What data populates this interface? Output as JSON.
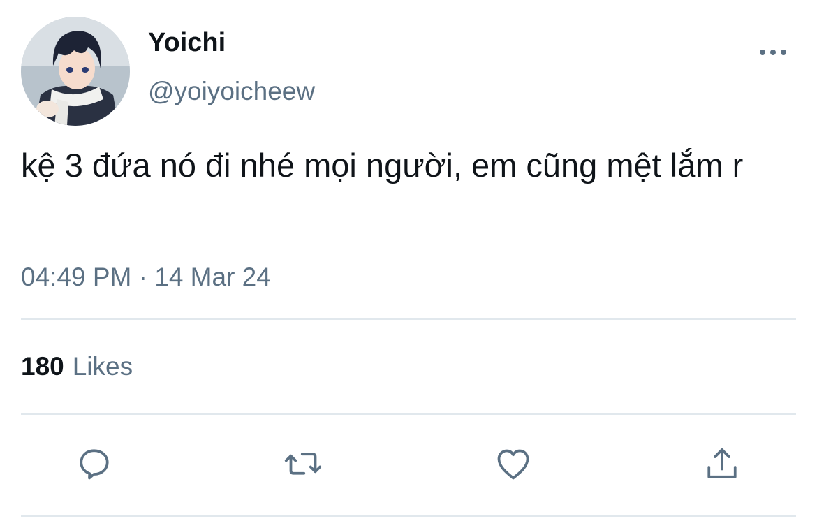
{
  "tweet": {
    "user": {
      "display_name": "Yoichi",
      "handle": "@yoiyoicheew",
      "avatar_icon": "anime-avatar"
    },
    "text": "kệ 3 đứa nó đi nhé mọi người, em cũng mệt lắm r",
    "timestamp": "04:49 PM · 14 Mar 24",
    "likes": {
      "count": "180",
      "label": "Likes"
    }
  },
  "actions": [
    {
      "name": "reply",
      "icon": "comment-icon"
    },
    {
      "name": "retweet",
      "icon": "retweet-icon"
    },
    {
      "name": "like",
      "icon": "heart-icon"
    },
    {
      "name": "share",
      "icon": "share-icon"
    }
  ],
  "colors": {
    "text_primary": "#0f1419",
    "text_secondary": "#5b7083",
    "divider": "#e1e8ed",
    "icon": "#5b7083"
  }
}
